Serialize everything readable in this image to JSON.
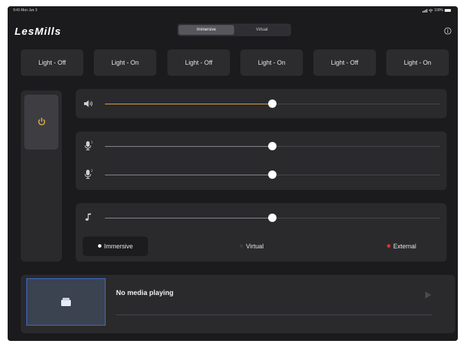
{
  "status": {
    "time": "9:41",
    "date": "Mon Jun 3",
    "battery": "100%"
  },
  "app": {
    "logo": "LesMills"
  },
  "tabs": [
    {
      "label": "Immersive",
      "active": true
    },
    {
      "label": "Virtual",
      "active": false
    }
  ],
  "lights": [
    {
      "label": "Light - Off"
    },
    {
      "label": "Light - On"
    },
    {
      "label": "Light - Off"
    },
    {
      "label": "Light - On"
    },
    {
      "label": "Light - Off"
    },
    {
      "label": "Light - On"
    }
  ],
  "power": {
    "icon": "power-icon",
    "color": "#f2b84b"
  },
  "sliders": {
    "volume": {
      "icon": "speaker-icon",
      "value": 0.5,
      "fill_color": "#e2a93a"
    },
    "mic1": {
      "icon": "microphone-1-icon",
      "value": 0.5
    },
    "mic2": {
      "icon": "microphone-2-icon",
      "value": 0.5
    },
    "music": {
      "icon": "music-note-icon",
      "value": 0.5
    }
  },
  "modes": [
    {
      "label": "Immersive",
      "dot_color": "#ffffff",
      "active": true
    },
    {
      "label": "Virtual",
      "dot_color": "#3a3a3e",
      "active": false
    },
    {
      "label": "External",
      "dot_color": "#e0302a",
      "active": false
    }
  ],
  "media": {
    "title": "No media playing",
    "progress": 0
  }
}
